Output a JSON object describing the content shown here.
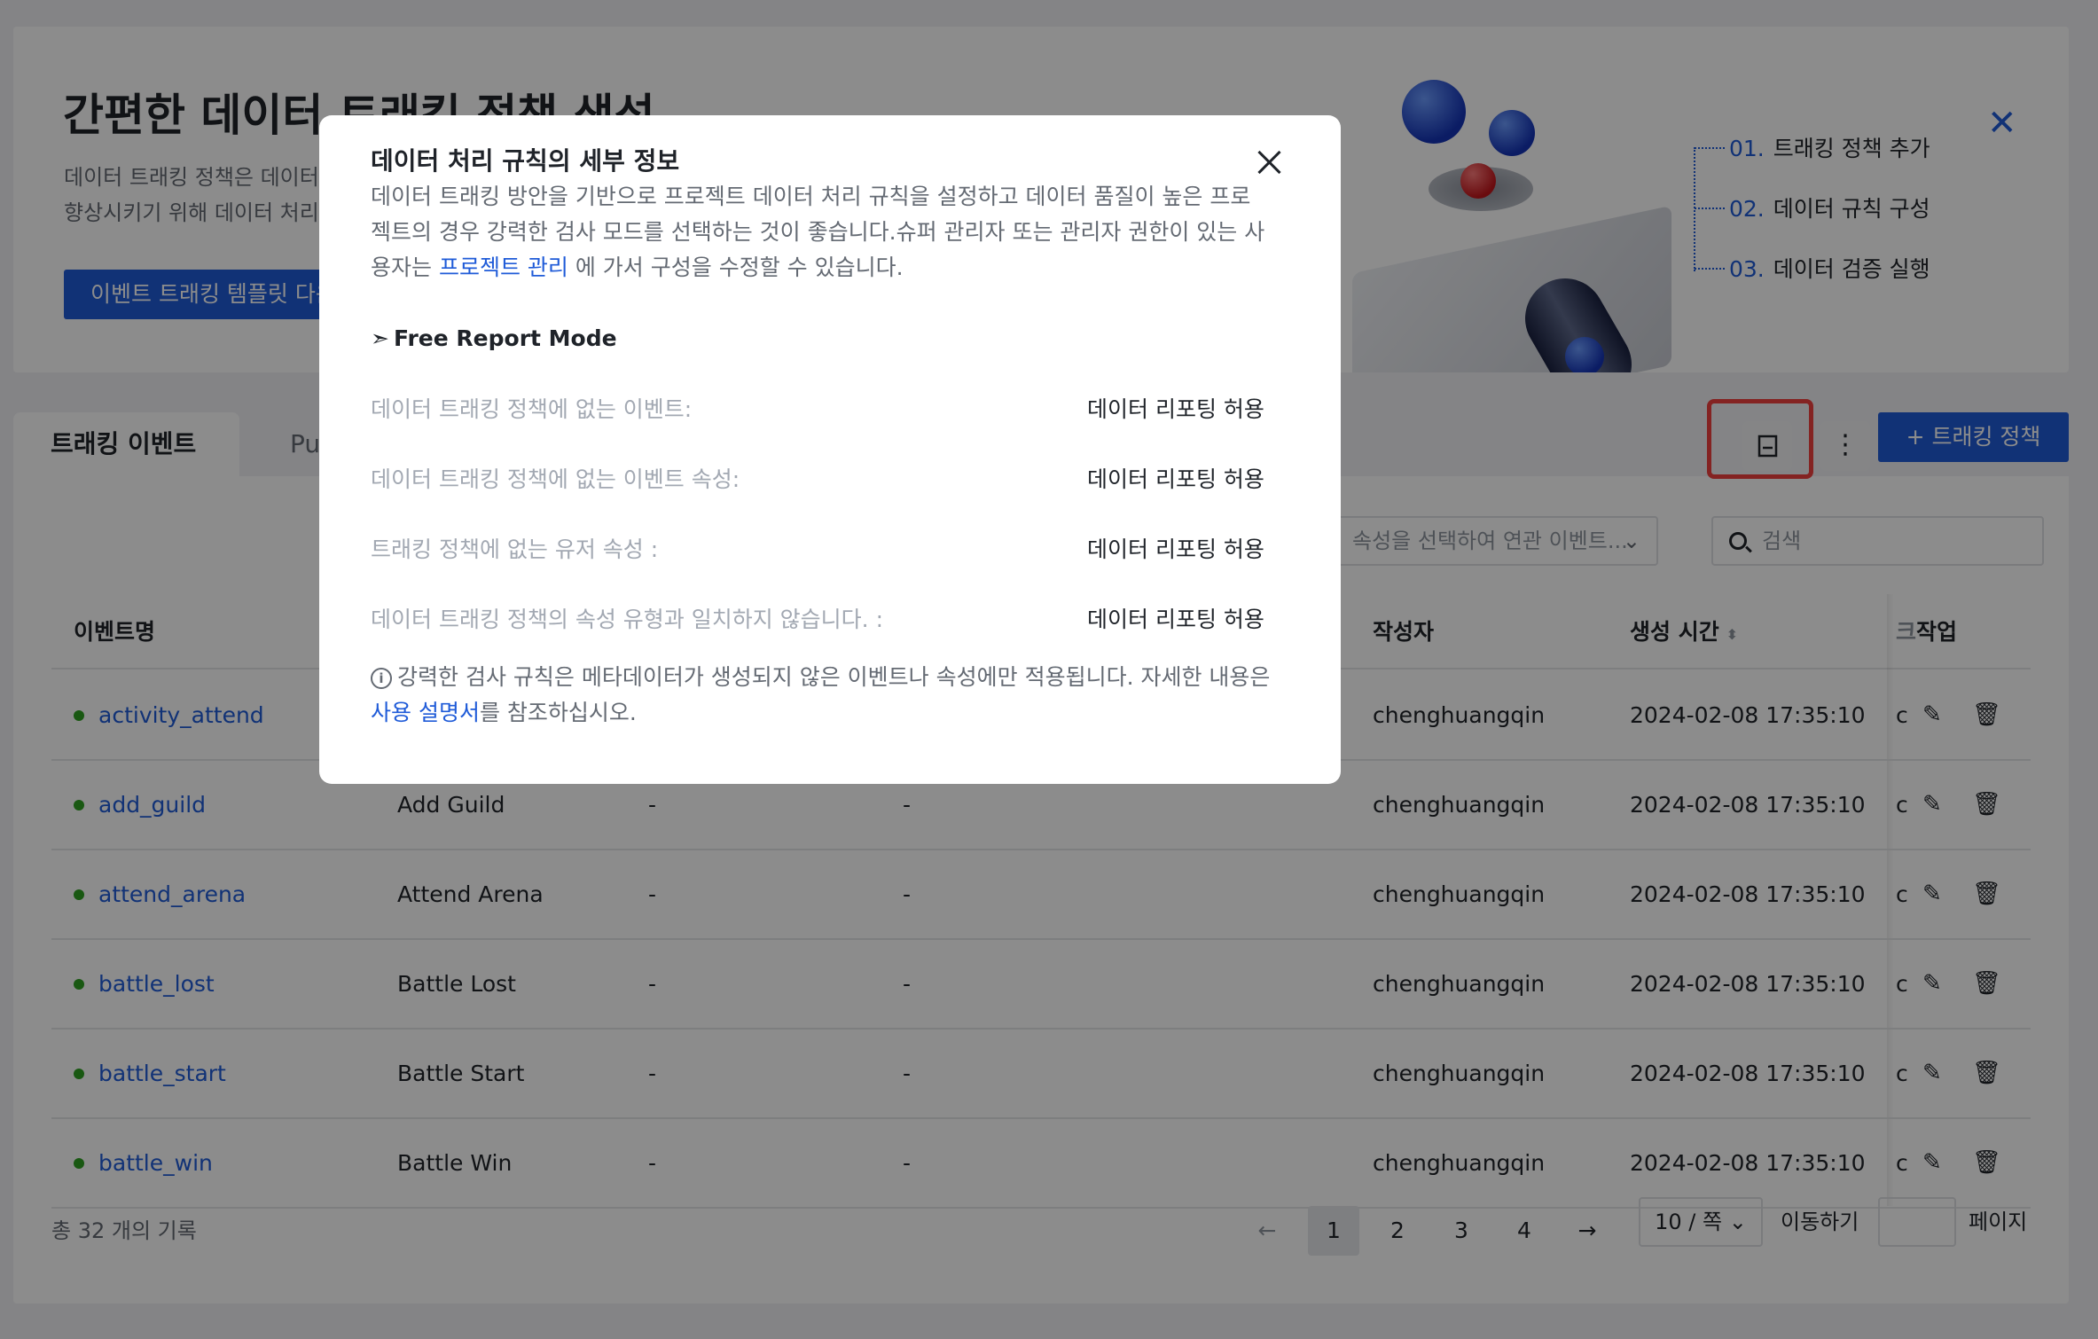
{
  "banner": {
    "title": "간편한 데이터 트래킹 정책 생성",
    "desc_line1": "데이터 트래킹 정책은 데이터",
    "desc_line2": "향상시키기 위해 데이터 처리",
    "button": "이벤트 트래킹 템플릿 다운로드",
    "steps": [
      {
        "num": "01.",
        "label": "트래킹 정책 추가"
      },
      {
        "num": "02.",
        "label": "데이터 규칙 구성"
      },
      {
        "num": "03.",
        "label": "데이터 검증 실행"
      }
    ]
  },
  "tabs": {
    "active": "트래킹 이벤트",
    "second": "Pu"
  },
  "toolbar": {
    "more_label": "⋮",
    "add_button": "+ 트래킹 정책"
  },
  "filter": {
    "select_placeholder": "속성을 선택하여 연관 이벤트...",
    "select_chevron": "⌄",
    "search_placeholder": "검색"
  },
  "table": {
    "headers": {
      "event_name": "이벤트명",
      "author": "작성자",
      "created_time": "생성 시간",
      "sort_glyph": "⬍",
      "cut_col": "크",
      "action": "작업"
    },
    "action_icons": {
      "edit": "✎",
      "delete": "🗑"
    },
    "rows": [
      {
        "name": "activity_attend",
        "display": "",
        "col3": "",
        "col4": "",
        "author": "chenghuangqin",
        "time": "2024-02-08 17:35:10",
        "cut": "c"
      },
      {
        "name": "add_guild",
        "display": "Add Guild",
        "col3": "-",
        "col4": "-",
        "author": "chenghuangqin",
        "time": "2024-02-08 17:35:10",
        "cut": "c"
      },
      {
        "name": "attend_arena",
        "display": "Attend Arena",
        "col3": "-",
        "col4": "-",
        "author": "chenghuangqin",
        "time": "2024-02-08 17:35:10",
        "cut": "c"
      },
      {
        "name": "battle_lost",
        "display": "Battle Lost",
        "col3": "-",
        "col4": "-",
        "author": "chenghuangqin",
        "time": "2024-02-08 17:35:10",
        "cut": "c"
      },
      {
        "name": "battle_start",
        "display": "Battle Start",
        "col3": "-",
        "col4": "-",
        "author": "chenghuangqin",
        "time": "2024-02-08 17:35:10",
        "cut": "c"
      },
      {
        "name": "battle_win",
        "display": "Battle Win",
        "col3": "-",
        "col4": "-",
        "author": "chenghuangqin",
        "time": "2024-02-08 17:35:10",
        "cut": "c"
      }
    ]
  },
  "pagination": {
    "total": "총 32 개의 기록",
    "prev": "←",
    "next": "→",
    "pages": [
      "1",
      "2",
      "3",
      "4"
    ],
    "current": "1",
    "page_size": "10 / 쪽 ⌄",
    "goto_label": "이동하기",
    "page_label": "페이지"
  },
  "modal": {
    "title": "데이터 처리 규칙의 세부 정보",
    "desc_before_link": "데이터 트래킹 방안을 기반으로 프로젝트 데이터 처리 규칙을 설정하고 데이터 품질이 높은 프로젝트의 경우 강력한 검사 모드를 선택하는 것이 좋습니다.슈퍼 관리자 또는 관리자 권한이 있는 사용자는 ",
    "desc_link": "프로젝트 관리",
    "desc_after_link": " 에 가서 구성을 수정할 수 있습니다.",
    "mode_icon": "➣",
    "mode": "Free Report Mode",
    "rules": [
      {
        "label": "데이터 트래킹 정책에 없는 이벤트:",
        "value": "데이터 리포팅 허용"
      },
      {
        "label": "데이터 트래킹 정책에 없는 이벤트 속성:",
        "value": "데이터 리포팅 허용"
      },
      {
        "label": "트래킹 정책에 없는 유저 속성 :",
        "value": "데이터 리포팅 허용"
      },
      {
        "label": "데이터 트래킹 정책의 속성 유형과 일치하지 않습니다. :",
        "value": "데이터 리포팅 허용"
      }
    ],
    "note_icon": "i",
    "note_before_link": "강력한 검사 규칙은 메타데이터가 생성되지 않은 이벤트나 속성에만 적용됩니다. 자세한 내용은 ",
    "note_link": "사용 설명서",
    "note_after_link": "를 참조하십시오."
  }
}
